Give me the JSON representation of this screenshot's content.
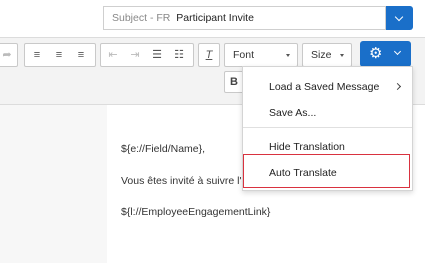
{
  "subject": {
    "prefix": "Subject - FR",
    "value": "Participant Invite"
  },
  "toolbar": {
    "font_label": "Font",
    "size_label": "Size",
    "bold_label": "B",
    "format_icons": [
      "redo-icon",
      "align-left-icon",
      "align-center-icon",
      "align-right-icon",
      "outdent-icon",
      "indent-icon",
      "numbered-list-icon",
      "bulleted-list-icon",
      "clear-format-icon"
    ]
  },
  "menu": {
    "items": [
      {
        "label": "Load a Saved Message",
        "has_submenu": true
      },
      {
        "label": "Save As..."
      },
      {
        "label": "Hide Translation"
      },
      {
        "label": "Auto Translate",
        "highlighted": true
      }
    ]
  },
  "editor": {
    "lines": [
      "${e://Field/Name},",
      "Vous êtes invité à suivre l'e",
      "${l://EmployeeEngagementLink}"
    ]
  },
  "colors": {
    "accent": "#1a6fc9",
    "highlight_border": "#d9323f"
  }
}
